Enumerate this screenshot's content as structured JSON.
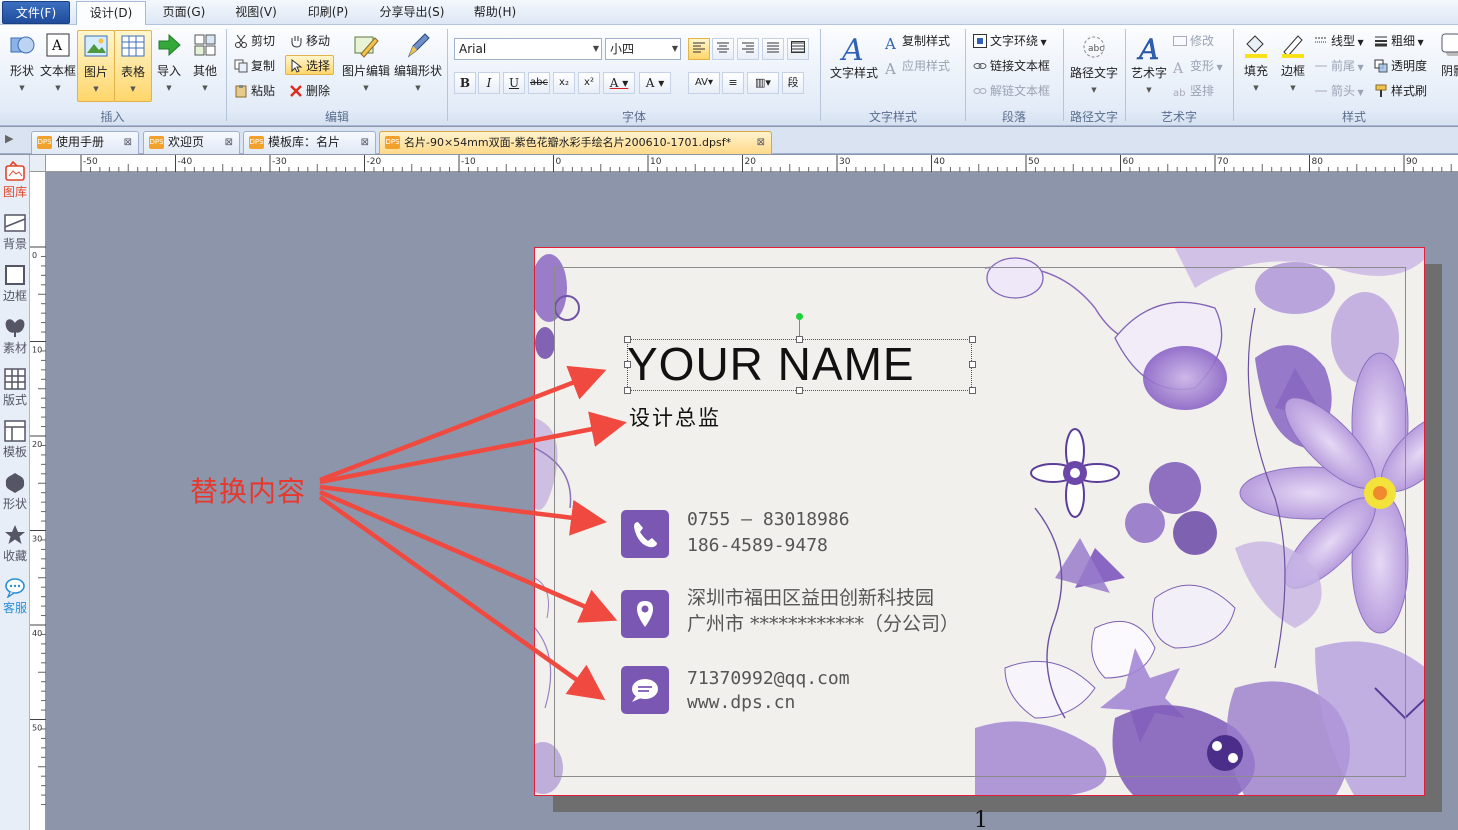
{
  "menu": {
    "file": "文件(F)",
    "design": "设计(D)",
    "page": "页面(G)",
    "view": "视图(V)",
    "print": "印刷(P)",
    "share": "分享导出(S)",
    "help": "帮助(H)"
  },
  "ribbon": {
    "insert": {
      "shape": "形状",
      "textbox": "文本框",
      "image": "图片",
      "table": "表格",
      "import": "导入",
      "other": "其他",
      "group": "插入"
    },
    "edit": {
      "cut": "剪切",
      "move": "移动",
      "copy": "复制",
      "select": "选择",
      "paste": "粘贴",
      "delete": "删除",
      "image_edit": "图片编辑",
      "edit_shape": "编辑形状",
      "group": "编辑"
    },
    "font": {
      "family": "Arial",
      "size": "小四",
      "group": "字体"
    },
    "text_style": {
      "text_style": "文字样式",
      "copy_style": "复制样式",
      "apply_style": "应用样式",
      "group": "文字样式"
    },
    "paragraph": {
      "wrap": "文字环绕",
      "link": "链接文本框",
      "unlink": "解链文本框",
      "group": "段落"
    },
    "path_text": {
      "label": "路径文字",
      "group": "路径文字"
    },
    "art_text": {
      "label": "艺术字",
      "modify": "修改",
      "transform": "变形",
      "vertical": "竖排",
      "group": "艺术字"
    },
    "style": {
      "fill": "填充",
      "border": "边框",
      "line_type": "线型",
      "thickness": "粗细",
      "front_arrow": "前尾",
      "transparency": "透明度",
      "arrow": "箭头",
      "format_painter": "样式刷",
      "shadow": "阴影",
      "group": "样式"
    }
  },
  "tabs": [
    {
      "label": "使用手册"
    },
    {
      "label": "欢迎页"
    },
    {
      "label": "模板库：名片"
    },
    {
      "label": "名片-90×54mm双面-紫色花瓣水彩手绘名片200610-1701.dpsf*"
    }
  ],
  "sidebar": [
    {
      "label": "图库",
      "icon": "gallery-icon"
    },
    {
      "label": "背景",
      "icon": "background-icon"
    },
    {
      "label": "边框",
      "icon": "border-icon"
    },
    {
      "label": "素材",
      "icon": "material-icon"
    },
    {
      "label": "版式",
      "icon": "layout-icon"
    },
    {
      "label": "模板",
      "icon": "template-icon"
    },
    {
      "label": "形状",
      "icon": "shape-icon"
    },
    {
      "label": "收藏",
      "icon": "favorite-icon"
    },
    {
      "label": "客服",
      "icon": "customer-service-icon"
    }
  ],
  "ruler": {
    "h": [
      "-50",
      "-40",
      "-30",
      "-20",
      "-10",
      "0",
      "10",
      "20",
      "30",
      "40",
      "50",
      "60",
      "70",
      "80",
      "90"
    ],
    "v": [
      "0",
      "10",
      "20",
      "30",
      "40",
      "50"
    ]
  },
  "card": {
    "name": "YOUR NAME",
    "title": "设计总监",
    "phone1": "0755 — 83018986",
    "phone2": "186-4589-9478",
    "address1": "深圳市福田区益田创新科技园",
    "address2": "广州市 ************（分公司）",
    "email": "71370992@qq.com",
    "website": "www.dps.cn",
    "page_number": "1"
  },
  "annotation": {
    "label": "替换内容",
    "color": "#e8382e"
  },
  "colors": {
    "accent_purple": "#7b57b4",
    "selection_yellow": "#ffd66b",
    "page_border": "#e0203a"
  }
}
